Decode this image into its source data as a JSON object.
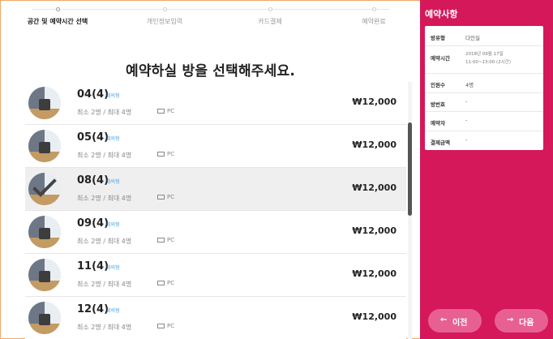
{
  "steps": [
    {
      "label": "공간 및 예약시간 선택",
      "active": true
    },
    {
      "label": "개인정보입력",
      "active": false
    },
    {
      "label": "카드결제",
      "active": false
    },
    {
      "label": "예약완료",
      "active": false
    }
  ],
  "page_title": "예약하실 방을 선택해주세요.",
  "rooms": [
    {
      "name": "04(4)",
      "type": "회의형",
      "capacity": "최소  2명 / 최대  4명",
      "pc": "PC",
      "price": "₩12,000",
      "selected": false
    },
    {
      "name": "05(4)",
      "type": "회의형",
      "capacity": "최소  2명 / 최대  4명",
      "pc": "PC",
      "price": "₩12,000",
      "selected": false
    },
    {
      "name": "08(4)",
      "type": "회의형",
      "capacity": "최소  2명 / 최대  4명",
      "pc": "PC",
      "price": "₩12,000",
      "selected": true
    },
    {
      "name": "09(4)",
      "type": "회의형",
      "capacity": "최소  2명 / 최대  4명",
      "pc": "PC",
      "price": "₩12,000",
      "selected": false
    },
    {
      "name": "11(4)",
      "type": "회의형",
      "capacity": "최소  2명 / 최대  4명",
      "pc": "PC",
      "price": "₩12,000",
      "selected": false
    },
    {
      "name": "12(4)",
      "type": "회의형",
      "capacity": "최소  2명 / 최대  4명",
      "pc": "PC",
      "price": "₩12,000",
      "selected": false
    }
  ],
  "summary": {
    "title": "예약사항",
    "room_type_key": "방유형",
    "room_type_val": "다인실",
    "time_key": "예약시간",
    "time_date": "2018년 09월 17일",
    "time_range": "11:00~13:00 (2시간)",
    "people_key": "인원수",
    "people_val": "4명",
    "room_no_key": "방번호",
    "room_no_val": "-",
    "booker_key": "예약자",
    "booker_val": "-",
    "amount_key": "결제금액",
    "amount_val": "-"
  },
  "nav": {
    "prev": "이전",
    "next": "다음"
  },
  "colors": {
    "accent": "#d4185a",
    "button": "#e86092",
    "link": "#3a9be0"
  }
}
